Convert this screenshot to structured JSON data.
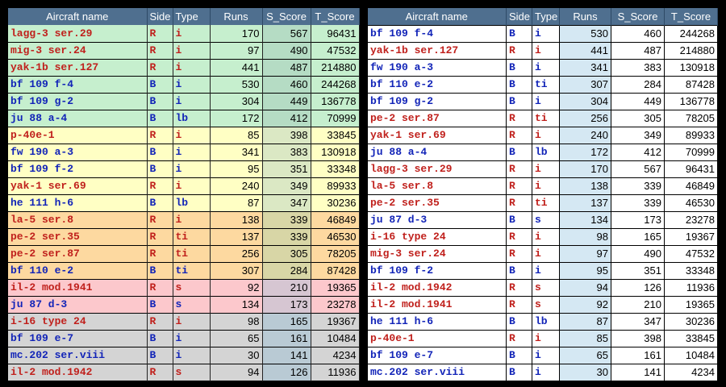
{
  "columns": [
    "Aircraft name",
    "Side",
    "Type",
    "Runs",
    "S_Score",
    "T_Score"
  ],
  "left_table": {
    "groups": [
      {
        "color": "#c6efce",
        "score_color": "#b5dcc4",
        "rows": [
          [
            "lagg-3 ser.29",
            "R",
            "i",
            170,
            567,
            96431
          ],
          [
            "mig-3 ser.24",
            "R",
            "i",
            97,
            490,
            47532
          ],
          [
            "yak-1b ser.127",
            "R",
            "i",
            441,
            487,
            214880
          ],
          [
            "bf 109 f-4",
            "B",
            "i",
            530,
            460,
            244268
          ],
          [
            "bf 109 g-2",
            "B",
            "i",
            304,
            449,
            136778
          ],
          [
            "ju 88 a-4",
            "B",
            "lb",
            172,
            412,
            70999
          ]
        ]
      },
      {
        "color": "#ffffc4",
        "score_color": "#dbe8c4",
        "rows": [
          [
            "p-40e-1",
            "R",
            "i",
            85,
            398,
            33845
          ],
          [
            "fw 190 a-3",
            "B",
            "i",
            341,
            383,
            130918
          ],
          [
            "bf 109 f-2",
            "B",
            "i",
            95,
            351,
            33348
          ],
          [
            "yak-1 ser.69",
            "R",
            "i",
            240,
            349,
            89933
          ],
          [
            "he 111 h-6",
            "B",
            "lb",
            87,
            347,
            30236
          ]
        ]
      },
      {
        "color": "#fdd9a0",
        "score_color": "#d8d6a6",
        "rows": [
          [
            "la-5 ser.8",
            "R",
            "i",
            138,
            339,
            46849
          ],
          [
            "pe-2 ser.35",
            "R",
            "ti",
            137,
            339,
            46530
          ],
          [
            "pe-2 ser.87",
            "R",
            "ti",
            256,
            305,
            78205
          ],
          [
            "bf 110 e-2",
            "B",
            "ti",
            307,
            284,
            87428
          ]
        ]
      },
      {
        "color": "#fcc8cc",
        "score_color": "#d6c6d2",
        "rows": [
          [
            "il-2 mod.1941",
            "R",
            "s",
            92,
            210,
            19365
          ],
          [
            "ju 87 d-3",
            "B",
            "s",
            134,
            173,
            23278
          ]
        ]
      },
      {
        "color": "#d4d4d4",
        "score_color": "#b9cad4",
        "rows": [
          [
            "i-16 type 24",
            "R",
            "i",
            98,
            165,
            19367
          ],
          [
            "bf 109 e-7",
            "B",
            "i",
            65,
            161,
            10484
          ],
          [
            "mc.202 ser.viii",
            "B",
            "i",
            30,
            141,
            4234
          ],
          [
            "il-2 mod.1942",
            "R",
            "s",
            94,
            126,
            11936
          ]
        ]
      }
    ]
  },
  "right_table": {
    "rows": [
      [
        "bf 109 f-4",
        "B",
        "i",
        530,
        460,
        244268
      ],
      [
        "yak-1b ser.127",
        "R",
        "i",
        441,
        487,
        214880
      ],
      [
        "fw 190 a-3",
        "B",
        "i",
        341,
        383,
        130918
      ],
      [
        "bf 110 e-2",
        "B",
        "ti",
        307,
        284,
        87428
      ],
      [
        "bf 109 g-2",
        "B",
        "i",
        304,
        449,
        136778
      ],
      [
        "pe-2 ser.87",
        "R",
        "ti",
        256,
        305,
        78205
      ],
      [
        "yak-1 ser.69",
        "R",
        "i",
        240,
        349,
        89933
      ],
      [
        "ju 88 a-4",
        "B",
        "lb",
        172,
        412,
        70999
      ],
      [
        "lagg-3 ser.29",
        "R",
        "i",
        170,
        567,
        96431
      ],
      [
        "la-5 ser.8",
        "R",
        "i",
        138,
        339,
        46849
      ],
      [
        "pe-2 ser.35",
        "R",
        "ti",
        137,
        339,
        46530
      ],
      [
        "ju 87 d-3",
        "B",
        "s",
        134,
        173,
        23278
      ],
      [
        "i-16 type 24",
        "R",
        "i",
        98,
        165,
        19367
      ],
      [
        "mig-3 ser.24",
        "R",
        "i",
        97,
        490,
        47532
      ],
      [
        "bf 109 f-2",
        "B",
        "i",
        95,
        351,
        33348
      ],
      [
        "il-2 mod.1942",
        "R",
        "s",
        94,
        126,
        11936
      ],
      [
        "il-2 mod.1941",
        "R",
        "s",
        92,
        210,
        19365
      ],
      [
        "he 111 h-6",
        "B",
        "lb",
        87,
        347,
        30236
      ],
      [
        "p-40e-1",
        "R",
        "i",
        85,
        398,
        33845
      ],
      [
        "bf 109 e-7",
        "B",
        "i",
        65,
        161,
        10484
      ],
      [
        "mc.202 ser.viii",
        "B",
        "i",
        30,
        141,
        4234
      ]
    ]
  }
}
